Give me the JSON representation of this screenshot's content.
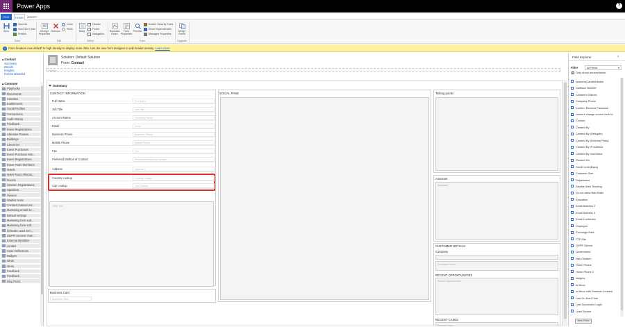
{
  "app": {
    "title": "Power Apps",
    "help": "?"
  },
  "tabs": {
    "file": "FILE",
    "home": "HOME",
    "insert": "INSERT"
  },
  "ribbon": {
    "save": "Save",
    "save_as": "Save As",
    "save_close": "Save and Close",
    "publish": "Publish",
    "change_props": "Change Properties",
    "remove": "Remove",
    "undo": "Undo",
    "redo": "Redo",
    "body": "Body",
    "header": "Header",
    "footer": "Footer",
    "navigation": "Navigation",
    "business_rules": "Business Rules",
    "form_props": "Form Properties",
    "preview": "Preview",
    "enable_roles": "Enable Security Roles",
    "show_deps": "Show Dependencies",
    "managed_props": "Managed Properties",
    "merge_forms": "Merge Forms",
    "groups": {
      "save": "Save",
      "edit": "Edit",
      "select": "Select",
      "form": "Form",
      "upgrade": "Upgrade"
    }
  },
  "banner": {
    "text": "Form headers now default to high density to display more data. Use the new form designer to edit header density.",
    "link": "Learn more"
  },
  "leftnav": {
    "contact_heading": "Contact",
    "links": [
      "Summary",
      "Details",
      "Insights",
      "Events attended"
    ],
    "common_heading": "Common",
    "entities": [
      "Playbooks",
      "Documents",
      "Activities",
      "Entitlements",
      "Social Profiles",
      "Connections",
      "Audit History",
      "Feedback",
      "Event Registrations",
      "Attendee Passes",
      "Buildings",
      "Check-ins",
      "Event Purchases",
      "Event Purchase Atte...",
      "Event Registrations",
      "Event Team Members",
      "Hotels",
      "Hotel Room Allocati...",
      "Rooms",
      "Session Registrations",
      "Speakers",
      "Venues",
      "Waitlist Items",
      "Contact channel act...",
      "Marketing emails te...",
      "Default settings",
      "Marketing form sub...",
      "Marketing form sub...",
      "LinkedIn Lead Gen...",
      "GDPR consent chan...",
      "External identities",
      "contact",
      "Case Deflections",
      "Badges",
      "Ideas",
      "Ideas",
      "Feedback",
      "Feedback",
      "Blog Posts"
    ]
  },
  "form": {
    "solution": "Solution: Default Solution",
    "form_label": "Form:",
    "form_name": "Contact",
    "header_placeholder": "Header",
    "tab_name": "Summary"
  },
  "contact_section": {
    "title": "CONTACT INFORMATION",
    "fields": [
      {
        "label": "Full Name",
        "placeholder": "Full Name"
      },
      {
        "label": "Job Title",
        "placeholder": "Job Title"
      },
      {
        "label": "Account Name",
        "placeholder": "Company Name"
      },
      {
        "label": "Email",
        "placeholder": "Email"
      },
      {
        "label": "Business Phone",
        "placeholder": "Business Phone"
      },
      {
        "label": "Mobile Phone",
        "placeholder": "Mobile Phone"
      },
      {
        "label": "Fax",
        "placeholder": "Fax"
      },
      {
        "label": "Preferred Method of Contact",
        "placeholder": "Preferred Method of Contact"
      },
      {
        "label": "Address",
        "placeholder": "Address 1"
      },
      {
        "label": "Country Lookup",
        "placeholder": "Country Lookup"
      },
      {
        "label": "City Lookup",
        "placeholder": "City Lookup"
      }
    ],
    "notes_placeholder": "Rich Text"
  },
  "business_card": {
    "title": "Business Card",
    "placeholder": "Business Card"
  },
  "social_pane": {
    "title": "SOCIAL PANE"
  },
  "talking_points": {
    "title": "Talking points"
  },
  "assistant": {
    "title": "Assistant",
    "placeholder": "Assistant"
  },
  "customer_details": {
    "title": "CUSTOMER DETAILS",
    "company_label": "Company",
    "company_placeholder": "Company Name"
  },
  "recent_opps": {
    "title": "RECENT OPPORTUNITIES",
    "placeholder": "Recent Opportunities"
  },
  "recent_cases": {
    "title": "RECENT CASES",
    "placeholder": "Recent Cases"
  },
  "field_explorer": {
    "title": "Field Explorer",
    "filter_label": "Filter",
    "filter_value": "All Fields",
    "only_unused": "Only show unused fields",
    "fields": [
      "businessCardAttributes",
      "Callback Number",
      "Children's Names",
      "Company Phone",
      "Confirm Remove Password",
      "consent change source form Id",
      "Contact",
      "Created By",
      "Created By (Delegate)",
      "Created By (External Party)",
      "Created By IP Address",
      "Created By Username",
      "Created On",
      "Credit Limit (Base)",
      "Customer Size",
      "Department",
      "Disable Web Tracking",
      "Do not allow Bulk Mails",
      "Education",
      "Email Address 2",
      "Email Address 3",
      "Email Confirmed",
      "Employee",
      "Exchange Rate",
      "FTP Site",
      "GDPR Optout",
      "Government",
      "Has Children",
      "Home Phone",
      "Home Phone 2",
      "Insights",
      "Is Minor",
      "Is Minor with Parental Consent",
      "Last On Hold Time",
      "Last Successful Login",
      "Lead Source"
    ],
    "new_field": "New Field"
  },
  "colors": {
    "brand": "#742774",
    "accent": "#2266c8",
    "highlight": "#e32d2d",
    "banner": "#fdf3a3"
  }
}
